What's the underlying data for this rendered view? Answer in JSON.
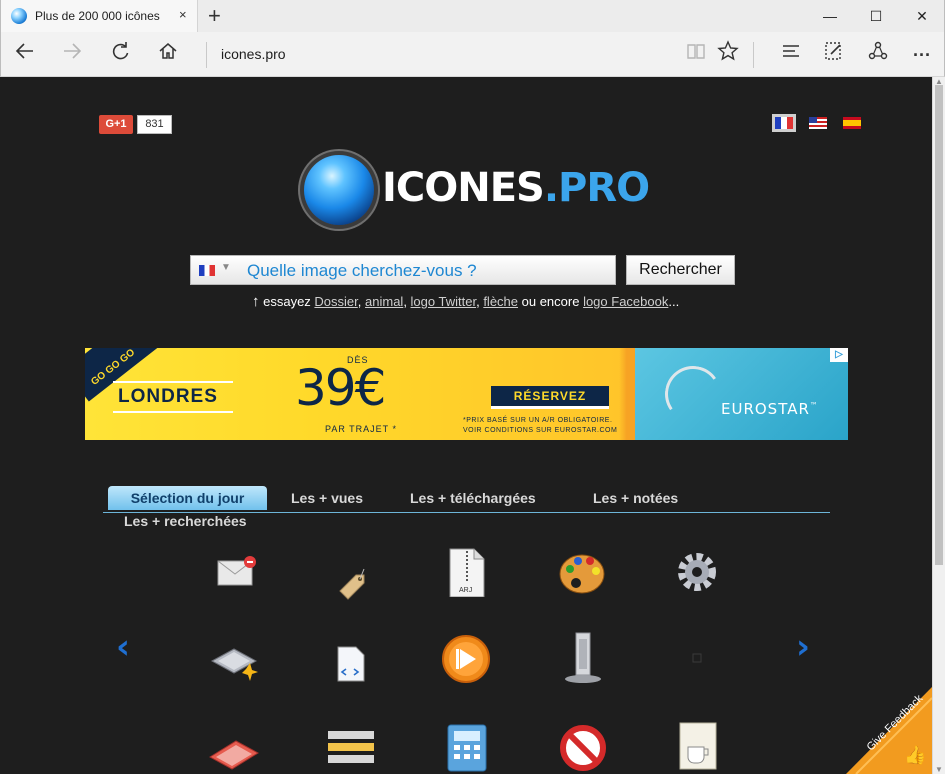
{
  "browser": {
    "tab_title": "Plus de 200 000 icônes",
    "tab_close": "×",
    "new_tab": "+",
    "win_min": "—",
    "win_max": "☐",
    "win_close": "✕",
    "url": "icones.pro"
  },
  "page": {
    "gplus_label": "G+1",
    "gplus_count": "831",
    "logo_main": "ICONES",
    "logo_ext": ".PRO",
    "search": {
      "placeholder": "Quelle image cherchez-vous ?",
      "button": "Rechercher"
    },
    "suggest": {
      "arrow": "↑",
      "prefix": " essayez ",
      "links": [
        "Dossier",
        "animal",
        "logo Twitter",
        "flèche"
      ],
      "middle": " ou encore ",
      "last_link": "logo Facebook",
      "suffix": "..."
    },
    "ad": {
      "gogo": "GO GO GO",
      "city": "LONDRES",
      "from": "DÈS",
      "price": "39€",
      "per": "PAR TRAJET *",
      "cta": "RÉSERVEZ",
      "fine1": "*PRIX BASÉ SUR UN A/R OBLIGATOIRE.",
      "fine2": "VOIR CONDITIONS SUR EUROSTAR.COM",
      "brand": "EUROSTAR",
      "tm": "™"
    },
    "tabs": [
      "Sélection du jour",
      "Les + vues",
      "Les + téléchargées",
      "Les + notées"
    ],
    "tab_more": "Les + recherchées",
    "carousel_prev": "‹",
    "carousel_next": "›",
    "icon_label_arj": "ARJ",
    "feedback": "Give Feedback",
    "colors": {
      "background": "#1e1e1e",
      "accent": "#3ba5ec",
      "tab_active": "#71c1ec"
    }
  }
}
